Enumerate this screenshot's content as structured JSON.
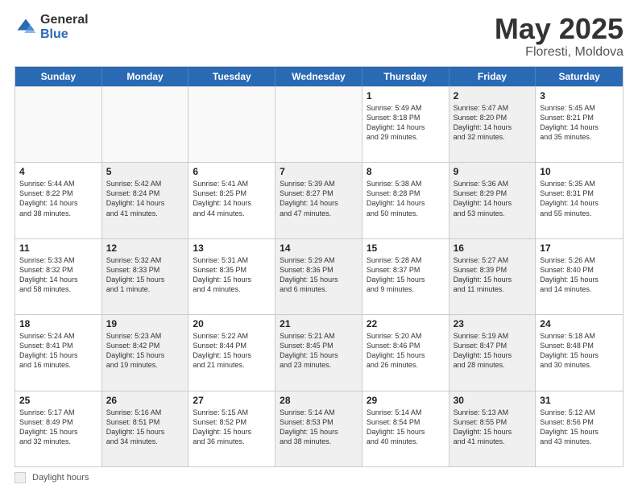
{
  "header": {
    "logo_general": "General",
    "logo_blue": "Blue",
    "title": "May 2025",
    "location": "Floresti, Moldova"
  },
  "calendar": {
    "days_of_week": [
      "Sunday",
      "Monday",
      "Tuesday",
      "Wednesday",
      "Thursday",
      "Friday",
      "Saturday"
    ],
    "weeks": [
      [
        {
          "day": "",
          "detail": "",
          "empty": true
        },
        {
          "day": "",
          "detail": "",
          "empty": true
        },
        {
          "day": "",
          "detail": "",
          "empty": true
        },
        {
          "day": "",
          "detail": "",
          "empty": true
        },
        {
          "day": "1",
          "detail": "Sunrise: 5:49 AM\nSunset: 8:18 PM\nDaylight: 14 hours\nand 29 minutes.",
          "shaded": false
        },
        {
          "day": "2",
          "detail": "Sunrise: 5:47 AM\nSunset: 8:20 PM\nDaylight: 14 hours\nand 32 minutes.",
          "shaded": true
        },
        {
          "day": "3",
          "detail": "Sunrise: 5:45 AM\nSunset: 8:21 PM\nDaylight: 14 hours\nand 35 minutes.",
          "shaded": false
        }
      ],
      [
        {
          "day": "4",
          "detail": "Sunrise: 5:44 AM\nSunset: 8:22 PM\nDaylight: 14 hours\nand 38 minutes.",
          "shaded": false
        },
        {
          "day": "5",
          "detail": "Sunrise: 5:42 AM\nSunset: 8:24 PM\nDaylight: 14 hours\nand 41 minutes.",
          "shaded": true
        },
        {
          "day": "6",
          "detail": "Sunrise: 5:41 AM\nSunset: 8:25 PM\nDaylight: 14 hours\nand 44 minutes.",
          "shaded": false
        },
        {
          "day": "7",
          "detail": "Sunrise: 5:39 AM\nSunset: 8:27 PM\nDaylight: 14 hours\nand 47 minutes.",
          "shaded": true
        },
        {
          "day": "8",
          "detail": "Sunrise: 5:38 AM\nSunset: 8:28 PM\nDaylight: 14 hours\nand 50 minutes.",
          "shaded": false
        },
        {
          "day": "9",
          "detail": "Sunrise: 5:36 AM\nSunset: 8:29 PM\nDaylight: 14 hours\nand 53 minutes.",
          "shaded": true
        },
        {
          "day": "10",
          "detail": "Sunrise: 5:35 AM\nSunset: 8:31 PM\nDaylight: 14 hours\nand 55 minutes.",
          "shaded": false
        }
      ],
      [
        {
          "day": "11",
          "detail": "Sunrise: 5:33 AM\nSunset: 8:32 PM\nDaylight: 14 hours\nand 58 minutes.",
          "shaded": false
        },
        {
          "day": "12",
          "detail": "Sunrise: 5:32 AM\nSunset: 8:33 PM\nDaylight: 15 hours\nand 1 minute.",
          "shaded": true
        },
        {
          "day": "13",
          "detail": "Sunrise: 5:31 AM\nSunset: 8:35 PM\nDaylight: 15 hours\nand 4 minutes.",
          "shaded": false
        },
        {
          "day": "14",
          "detail": "Sunrise: 5:29 AM\nSunset: 8:36 PM\nDaylight: 15 hours\nand 6 minutes.",
          "shaded": true
        },
        {
          "day": "15",
          "detail": "Sunrise: 5:28 AM\nSunset: 8:37 PM\nDaylight: 15 hours\nand 9 minutes.",
          "shaded": false
        },
        {
          "day": "16",
          "detail": "Sunrise: 5:27 AM\nSunset: 8:39 PM\nDaylight: 15 hours\nand 11 minutes.",
          "shaded": true
        },
        {
          "day": "17",
          "detail": "Sunrise: 5:26 AM\nSunset: 8:40 PM\nDaylight: 15 hours\nand 14 minutes.",
          "shaded": false
        }
      ],
      [
        {
          "day": "18",
          "detail": "Sunrise: 5:24 AM\nSunset: 8:41 PM\nDaylight: 15 hours\nand 16 minutes.",
          "shaded": false
        },
        {
          "day": "19",
          "detail": "Sunrise: 5:23 AM\nSunset: 8:42 PM\nDaylight: 15 hours\nand 19 minutes.",
          "shaded": true
        },
        {
          "day": "20",
          "detail": "Sunrise: 5:22 AM\nSunset: 8:44 PM\nDaylight: 15 hours\nand 21 minutes.",
          "shaded": false
        },
        {
          "day": "21",
          "detail": "Sunrise: 5:21 AM\nSunset: 8:45 PM\nDaylight: 15 hours\nand 23 minutes.",
          "shaded": true
        },
        {
          "day": "22",
          "detail": "Sunrise: 5:20 AM\nSunset: 8:46 PM\nDaylight: 15 hours\nand 26 minutes.",
          "shaded": false
        },
        {
          "day": "23",
          "detail": "Sunrise: 5:19 AM\nSunset: 8:47 PM\nDaylight: 15 hours\nand 28 minutes.",
          "shaded": true
        },
        {
          "day": "24",
          "detail": "Sunrise: 5:18 AM\nSunset: 8:48 PM\nDaylight: 15 hours\nand 30 minutes.",
          "shaded": false
        }
      ],
      [
        {
          "day": "25",
          "detail": "Sunrise: 5:17 AM\nSunset: 8:49 PM\nDaylight: 15 hours\nand 32 minutes.",
          "shaded": false
        },
        {
          "day": "26",
          "detail": "Sunrise: 5:16 AM\nSunset: 8:51 PM\nDaylight: 15 hours\nand 34 minutes.",
          "shaded": true
        },
        {
          "day": "27",
          "detail": "Sunrise: 5:15 AM\nSunset: 8:52 PM\nDaylight: 15 hours\nand 36 minutes.",
          "shaded": false
        },
        {
          "day": "28",
          "detail": "Sunrise: 5:14 AM\nSunset: 8:53 PM\nDaylight: 15 hours\nand 38 minutes.",
          "shaded": true
        },
        {
          "day": "29",
          "detail": "Sunrise: 5:14 AM\nSunset: 8:54 PM\nDaylight: 15 hours\nand 40 minutes.",
          "shaded": false
        },
        {
          "day": "30",
          "detail": "Sunrise: 5:13 AM\nSunset: 8:55 PM\nDaylight: 15 hours\nand 41 minutes.",
          "shaded": true
        },
        {
          "day": "31",
          "detail": "Sunrise: 5:12 AM\nSunset: 8:56 PM\nDaylight: 15 hours\nand 43 minutes.",
          "shaded": false
        }
      ]
    ]
  },
  "legend": {
    "label": "Daylight hours"
  }
}
